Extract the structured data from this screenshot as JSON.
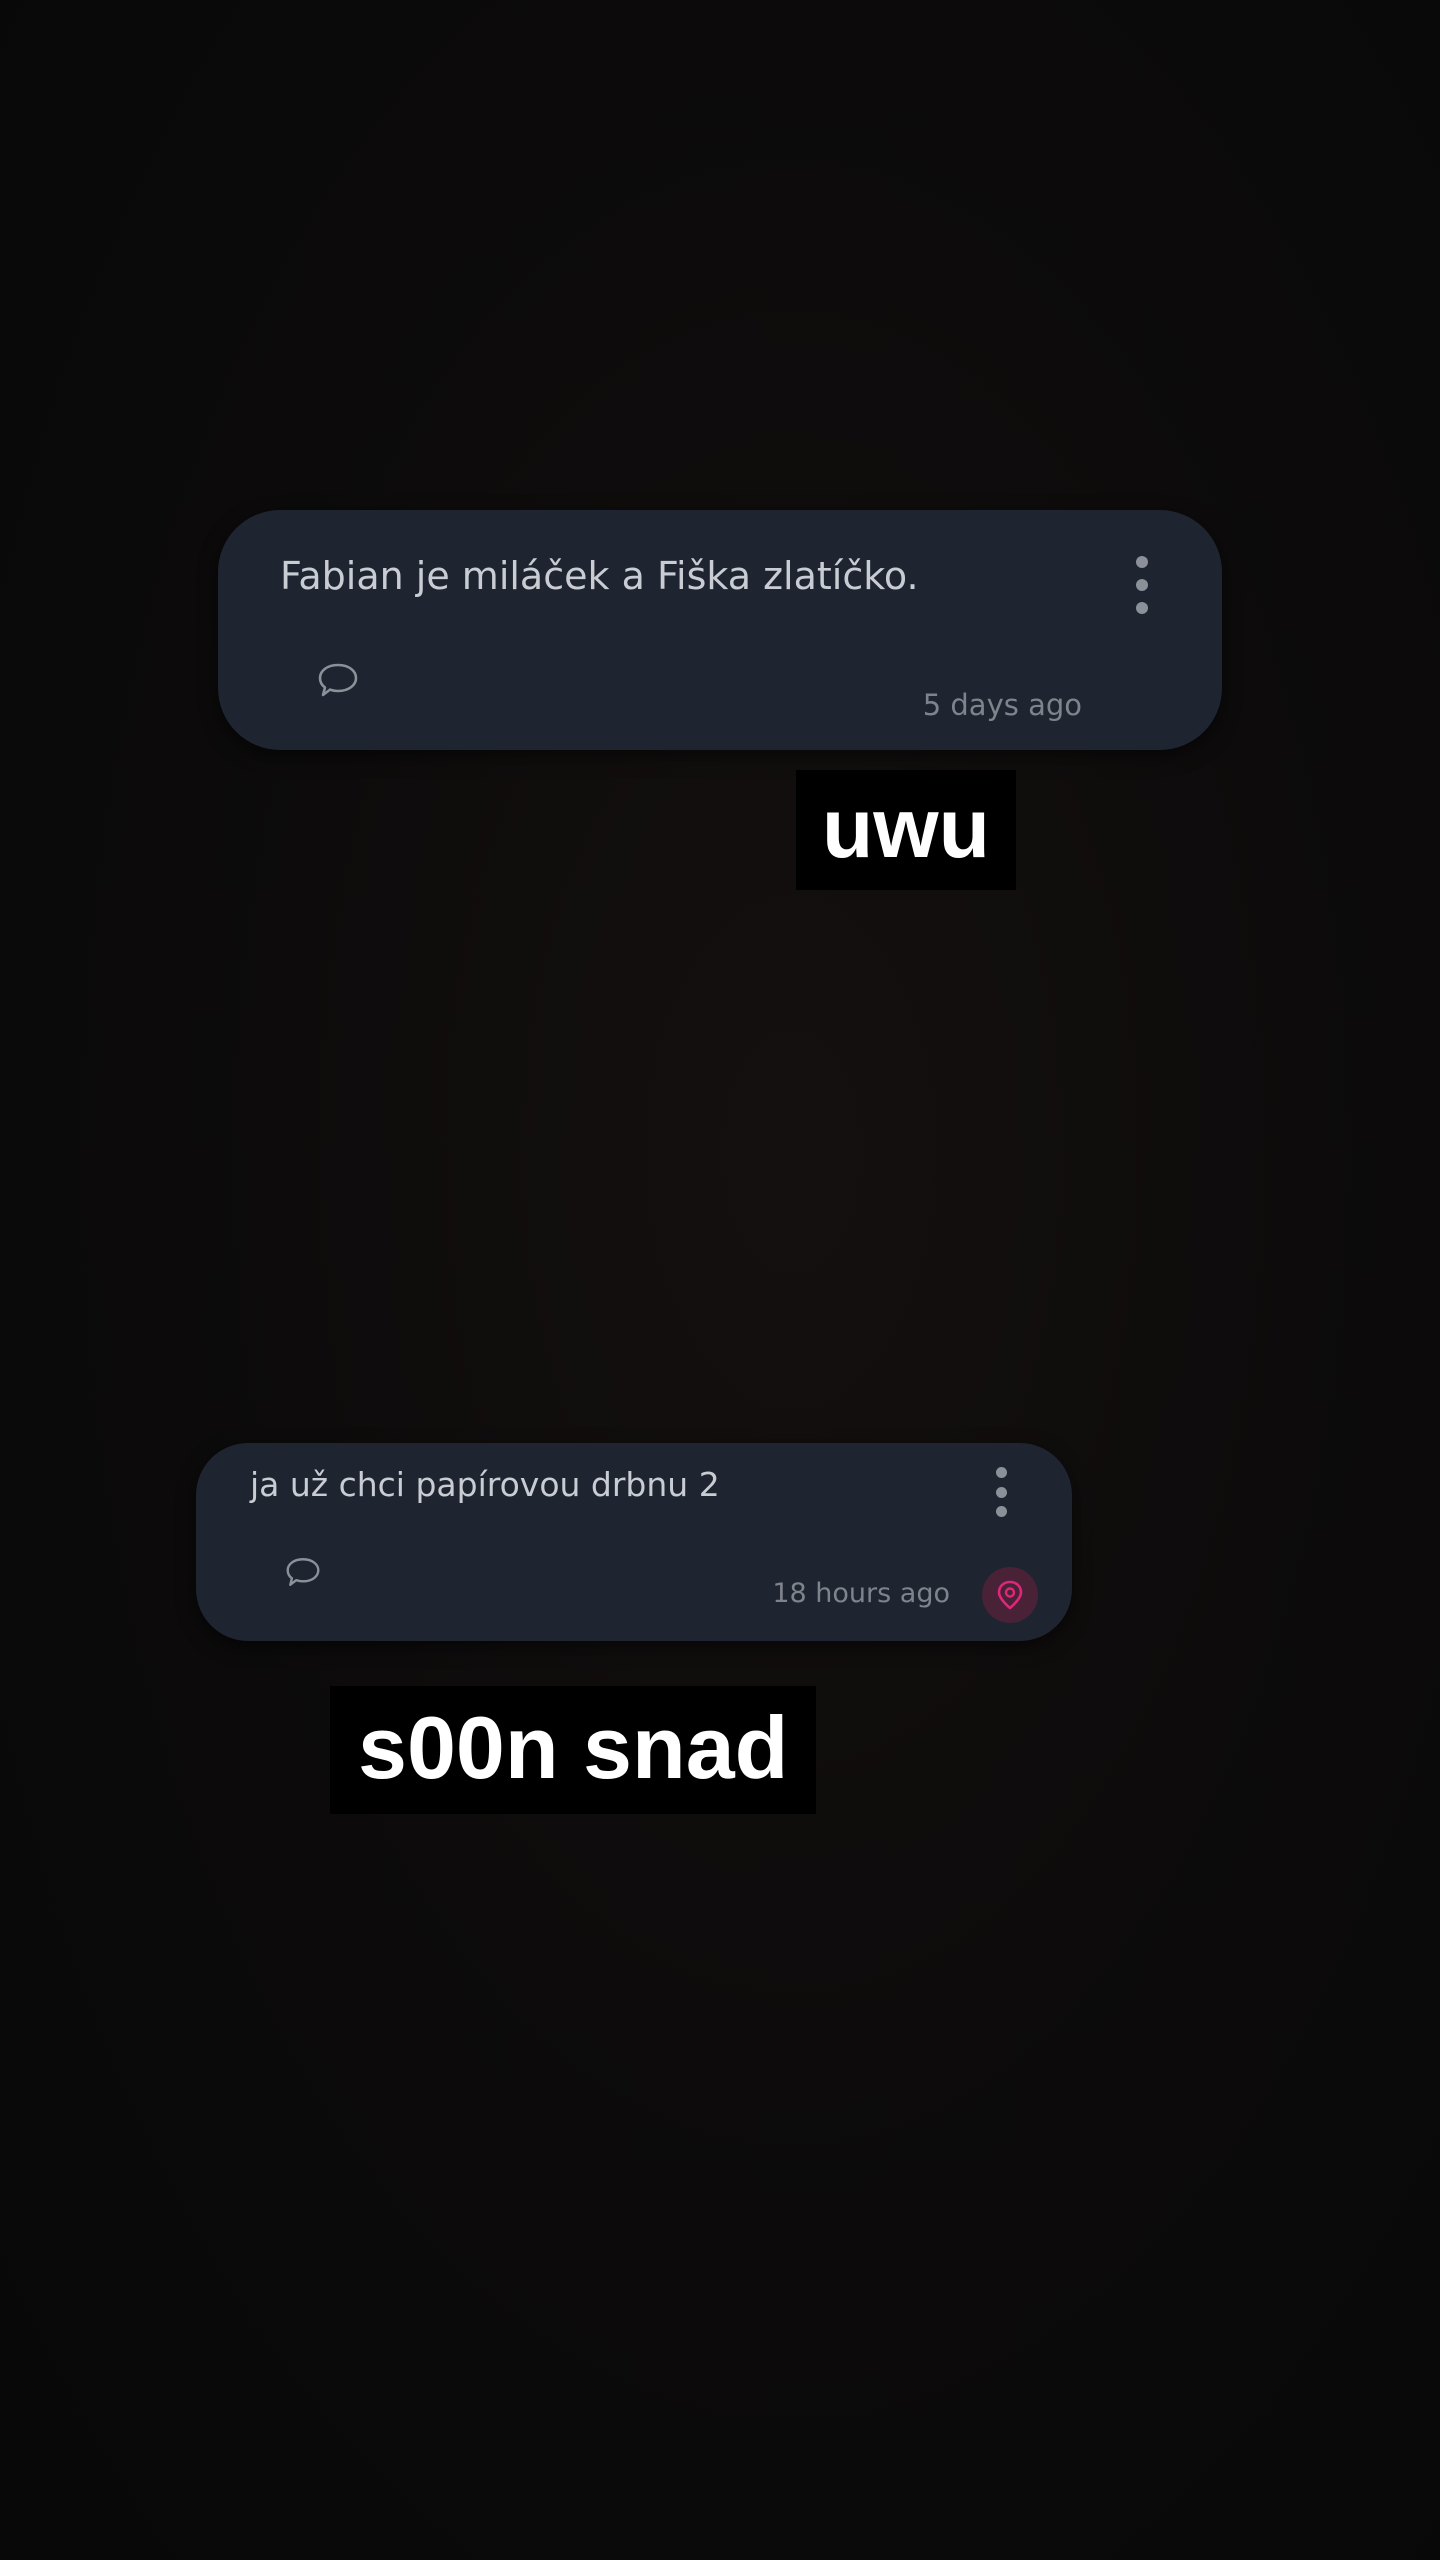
{
  "posts": [
    {
      "message": "Fabian je miláček a Fiška zlatíčko.",
      "time": "5 days ago",
      "comment_icon": "speech-bubble-icon",
      "menu_icon": "more-vert-icon"
    },
    {
      "message": "ja už chci papírovou drbnu 2",
      "time": "18 hours ago",
      "comment_icon": "speech-bubble-icon",
      "menu_icon": "more-vert-icon",
      "badge_icon": "location-pin-icon",
      "badge_color": "#e0267a"
    }
  ],
  "captions": {
    "first": "uwu",
    "second": "s00n snad"
  },
  "colors": {
    "card": "#1e2430",
    "background": "#0a0a0a",
    "text": "#c9ccd2",
    "muted": "#7f838b"
  }
}
